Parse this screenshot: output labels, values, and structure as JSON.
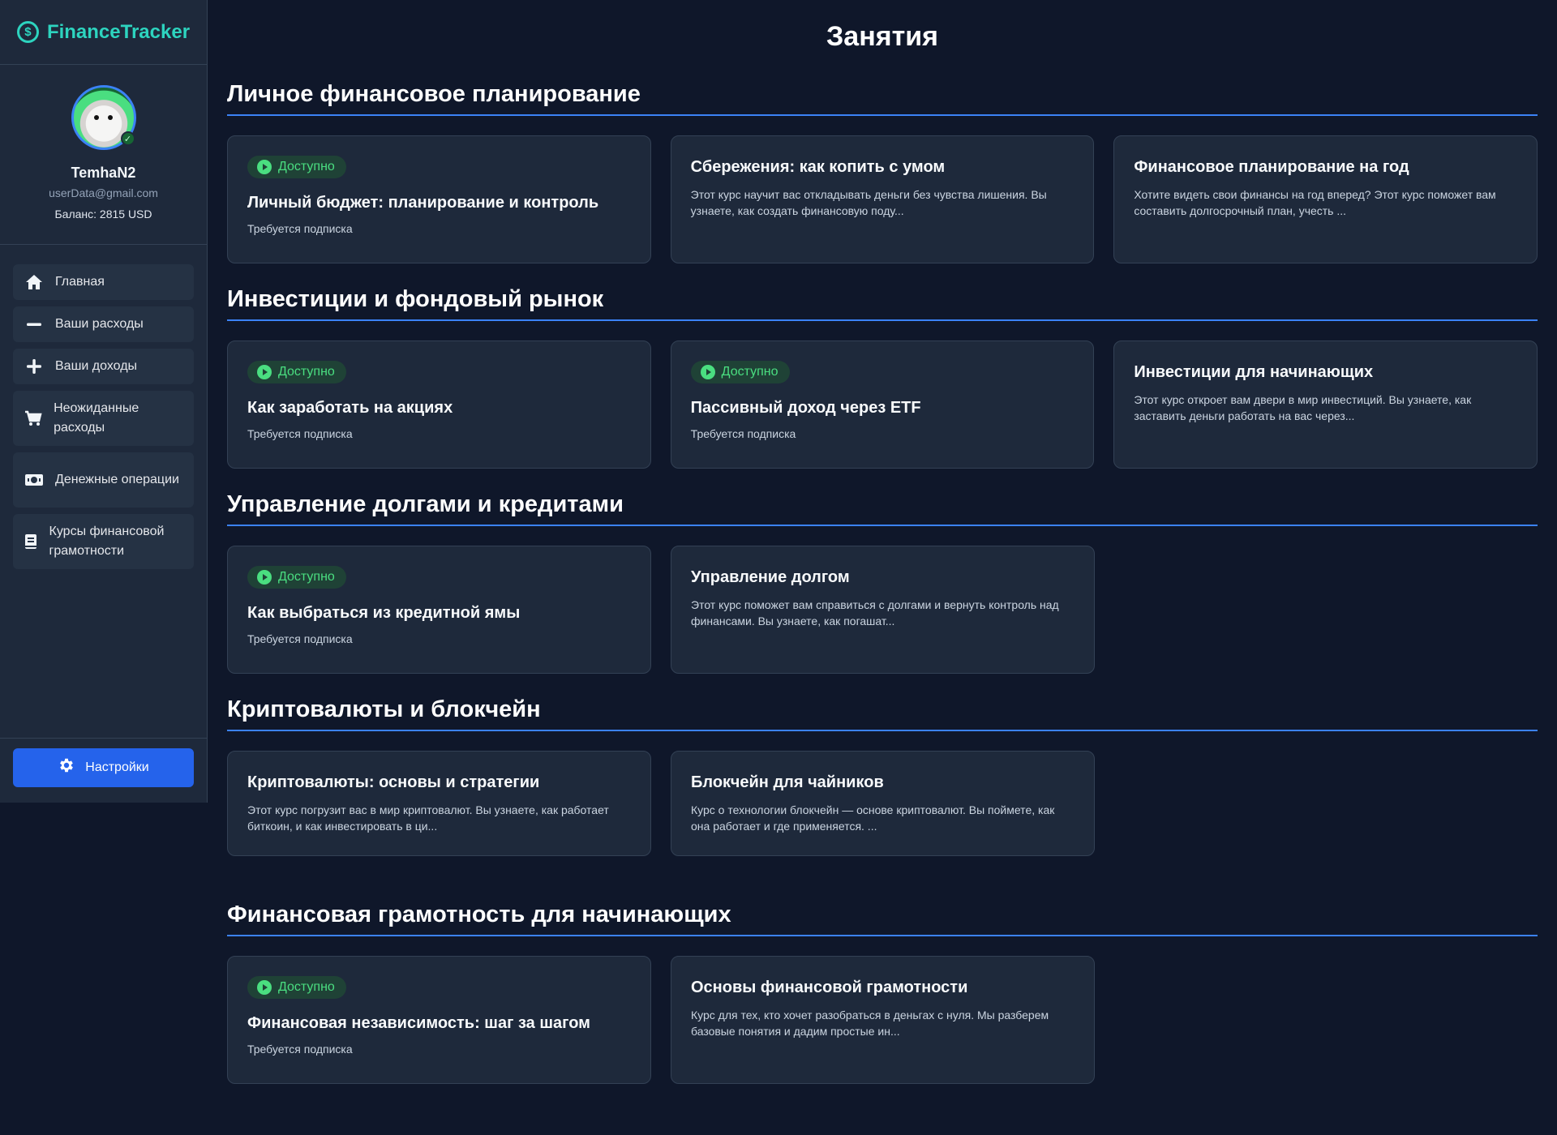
{
  "app": {
    "logo_text": "FinanceTracker",
    "logo_symbol": "$"
  },
  "profile": {
    "username": "TemhaN2",
    "email": "userData@gmail.com",
    "balance": "Баланс: 2815 USD"
  },
  "nav": {
    "items": [
      {
        "label": "Главная",
        "icon": "home-icon",
        "glyph": "⌂"
      },
      {
        "label": "Ваши расходы",
        "icon": "minus-icon",
        "glyph": "—"
      },
      {
        "label": "Ваши доходы",
        "icon": "plus-icon",
        "glyph": "+"
      },
      {
        "label": "Неожиданные расходы",
        "icon": "cart-icon",
        "glyph": "🛒"
      },
      {
        "label": "Денежные операции",
        "icon": "money-icon",
        "glyph": "💵"
      },
      {
        "label": "Курсы финансовой грамотности",
        "icon": "book-icon",
        "glyph": "▤"
      }
    ],
    "settings_label": "Настройки"
  },
  "main": {
    "title": "Занятия",
    "badge_label": "Доступно",
    "sections": [
      {
        "title": "Личное финансовое планирование",
        "cards": [
          {
            "title": "Личный бюджет: планирование и контроль",
            "available": true,
            "sub": "Требуется подписка"
          },
          {
            "title": "Сбережения: как копить с умом",
            "available": false,
            "desc": "Этот курс научит вас откладывать деньги без чувства лишения. Вы узнаете, как создать финансовую поду..."
          },
          {
            "title": "Финансовое планирование на год",
            "available": false,
            "desc": "Хотите видеть свои финансы на год вперед? Этот курс поможет вам составить долгосрочный план, учесть ..."
          }
        ]
      },
      {
        "title": "Инвестиции и фондовый рынок",
        "cards": [
          {
            "title": "Как заработать на акциях",
            "available": true,
            "sub": "Требуется подписка"
          },
          {
            "title": "Пассивный доход через ETF",
            "available": true,
            "sub": "Требуется подписка"
          },
          {
            "title": "Инвестиции для начинающих",
            "available": false,
            "desc": "Этот курс откроет вам двери в мир инвестиций. Вы узнаете, как заставить деньги работать на вас через..."
          }
        ]
      },
      {
        "title": "Управление долгами и кредитами",
        "cards": [
          {
            "title": "Как выбраться из кредитной ямы",
            "available": true,
            "sub": "Требуется подписка"
          },
          {
            "title": "Управление долгом",
            "available": false,
            "desc": "Этот курс поможет вам справиться с долгами и вернуть контроль над финансами. Вы узнаете, как погашат..."
          }
        ]
      },
      {
        "title": "Криптовалюты и блокчейн",
        "cards": [
          {
            "title": "Криптовалюты: основы и стратегии",
            "available": false,
            "desc": "Этот курс погрузит вас в мир криптовалют. Вы узнаете, как работает биткоин, и как инвестировать в ци..."
          },
          {
            "title": "Блокчейн для чайников",
            "available": false,
            "desc": "Курс о технологии блокчейн — основе криптовалют. Вы поймете, как она работает и где применяется. ..."
          }
        ]
      },
      {
        "title": "Финансовая грамотность для начинающих",
        "cards": [
          {
            "title": "Финансовая независимость: шаг за шагом",
            "available": true,
            "sub": "Требуется подписка"
          },
          {
            "title": "Основы финансовой грамотности",
            "available": false,
            "desc": "Курс для тех, кто хочет разобраться в деньгах с нуля. Мы разберем базовые понятия и дадим простые ин..."
          }
        ]
      }
    ]
  },
  "colors": {
    "accent": "#2563eb",
    "brand": "#2dd4bf",
    "available": "#4ade80",
    "background": "#0f172a",
    "card": "#1e293b"
  }
}
